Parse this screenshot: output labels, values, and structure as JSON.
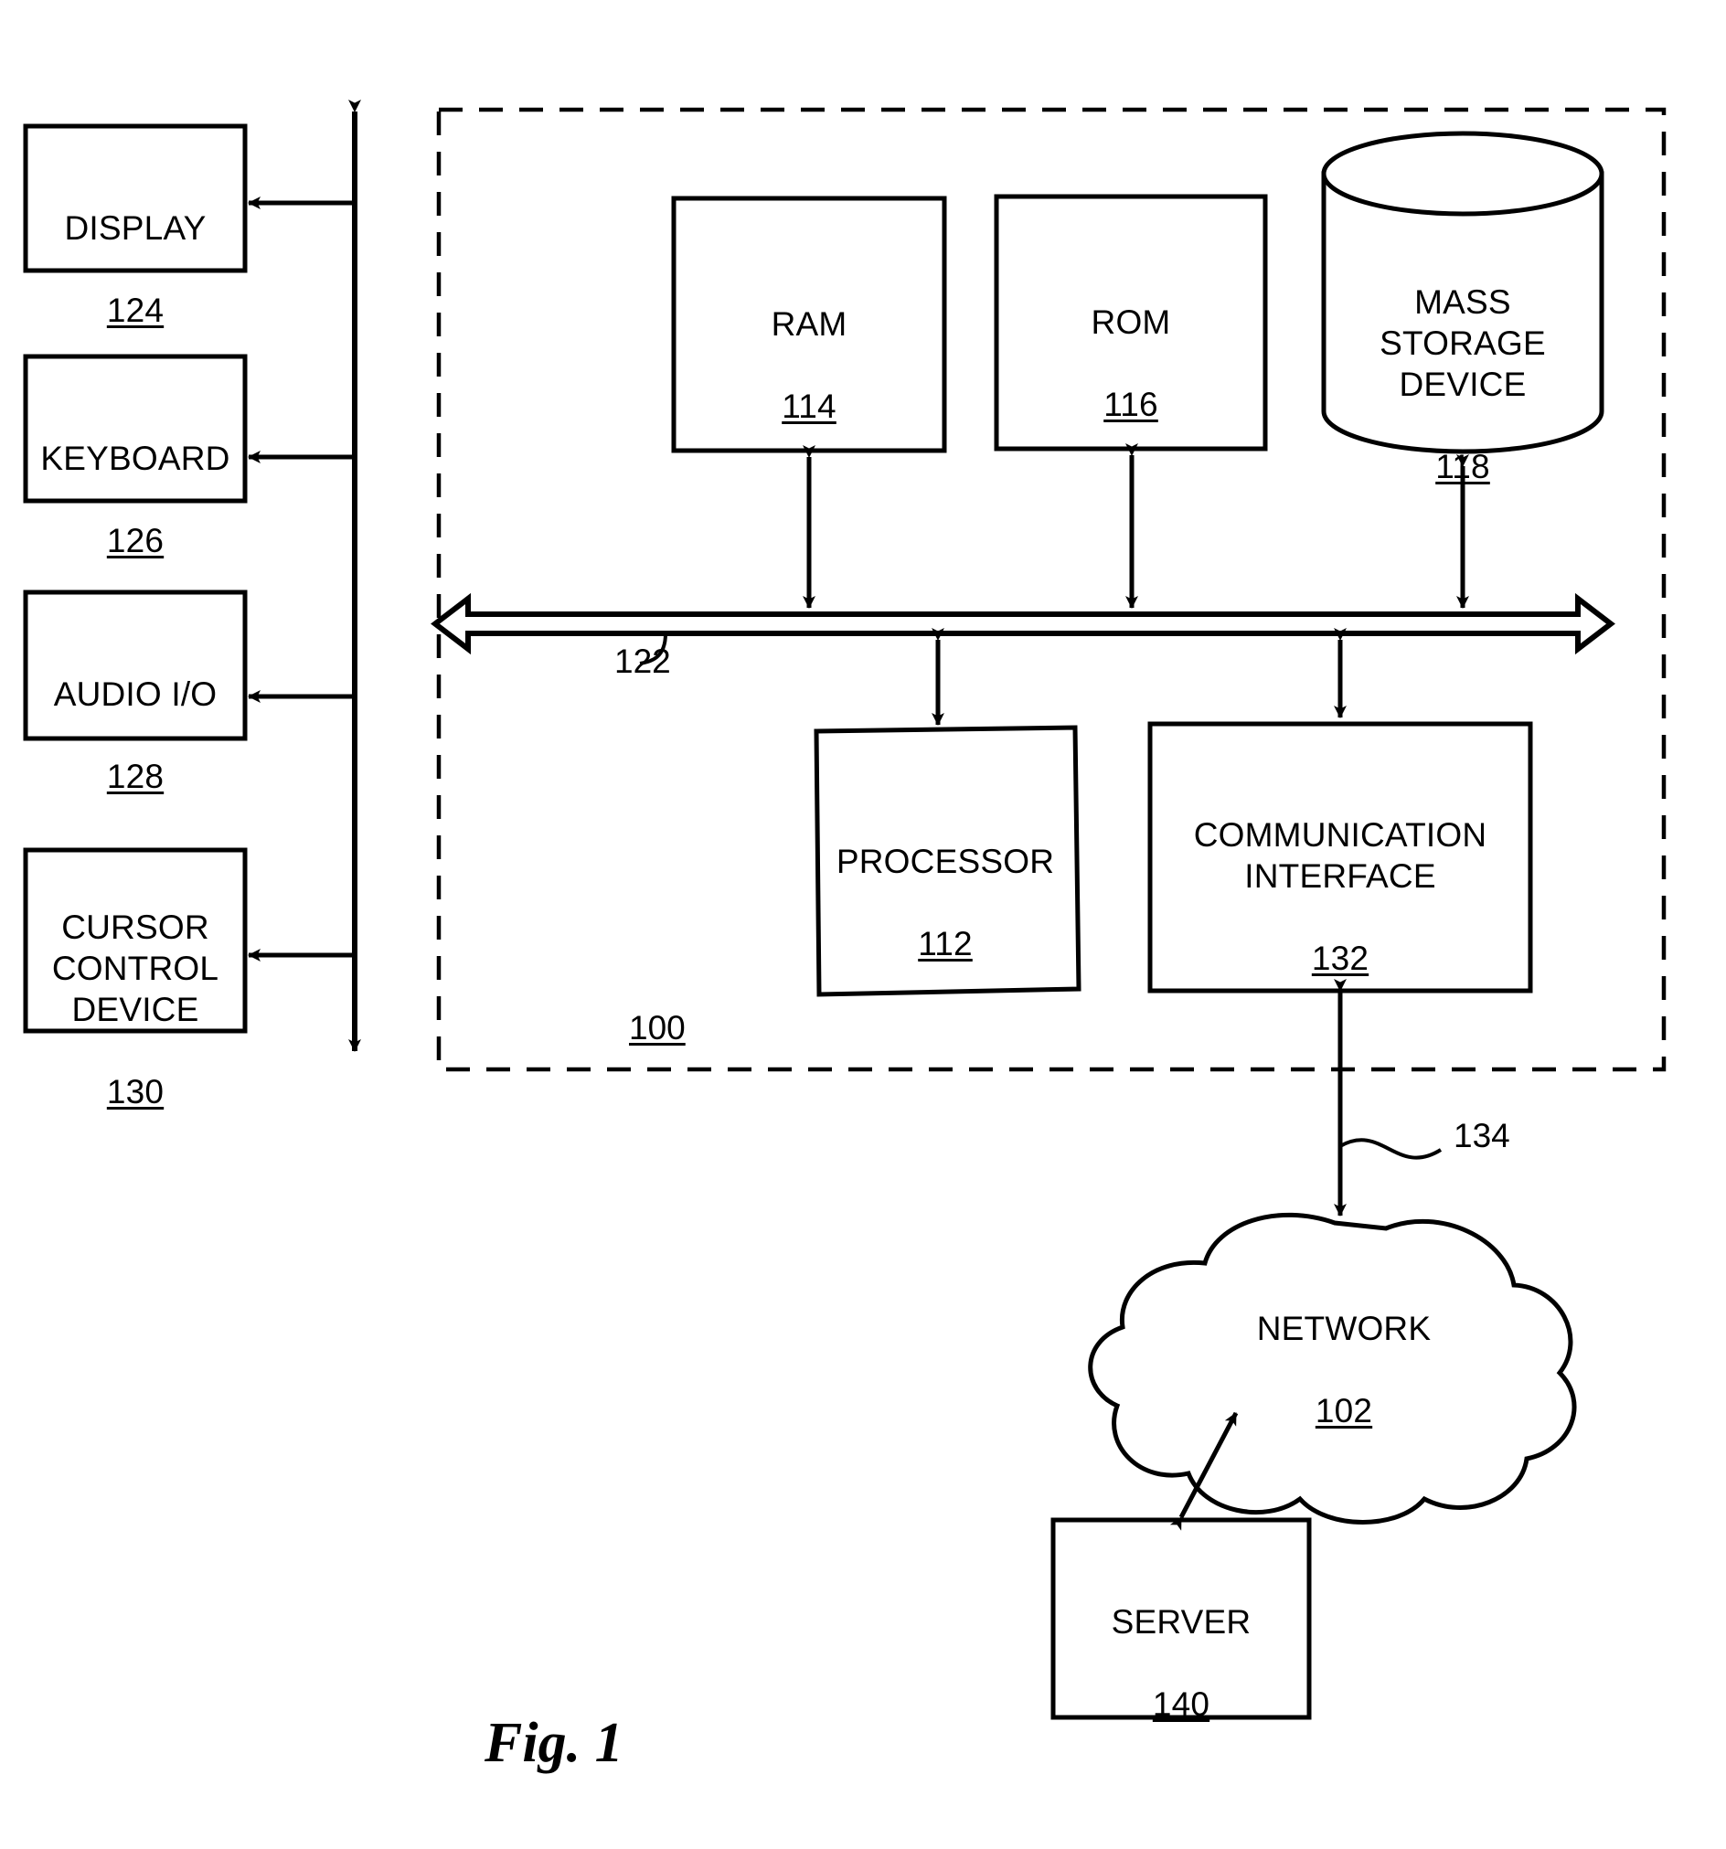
{
  "figure": {
    "caption": "Fig. 1",
    "system_ref": "100",
    "bus_ref": "122",
    "network_link_ref": "134"
  },
  "peripherals": [
    {
      "name": "DISPLAY",
      "ref": "124",
      "data_name": "display-block"
    },
    {
      "name": "KEYBOARD",
      "ref": "126",
      "data_name": "keyboard-block"
    },
    {
      "name": "AUDIO I/O",
      "ref": "128",
      "data_name": "audio-io-block"
    },
    {
      "name": "CURSOR\nCONTROL\nDEVICE",
      "ref": "130",
      "data_name": "cursor-control-device-block"
    }
  ],
  "memory": [
    {
      "name": "RAM",
      "ref": "114",
      "data_name": "ram-block"
    },
    {
      "name": "ROM",
      "ref": "116",
      "data_name": "rom-block"
    },
    {
      "name": "MASS\nSTORAGE\nDEVICE",
      "ref": "118",
      "data_name": "mass-storage-device-block"
    }
  ],
  "core": [
    {
      "name": "PROCESSOR",
      "ref": "112",
      "data_name": "processor-block"
    },
    {
      "name": "COMMUNICATION\nINTERFACE",
      "ref": "132",
      "data_name": "communication-interface-block"
    }
  ],
  "external": [
    {
      "name": "NETWORK",
      "ref": "102",
      "data_name": "network-cloud"
    },
    {
      "name": "SERVER",
      "ref": "140",
      "data_name": "server-block"
    }
  ],
  "colors": {
    "stroke": "#000000",
    "background": "#ffffff"
  }
}
